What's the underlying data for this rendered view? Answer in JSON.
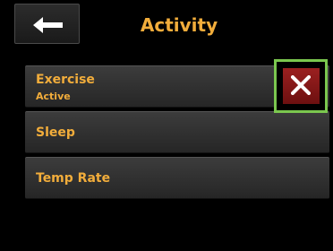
{
  "header": {
    "title": "Activity",
    "back_icon": "arrow-left-icon"
  },
  "activities": [
    {
      "label": "Exercise",
      "status": "Active"
    },
    {
      "label": "Sleep"
    },
    {
      "label": "Temp Rate"
    }
  ],
  "stop_button": {
    "icon": "close-x-icon",
    "color": "#8c1a1a",
    "highlight": "#7bc74f"
  },
  "colors": {
    "accent": "#f2ad3b",
    "background": "#000000"
  }
}
